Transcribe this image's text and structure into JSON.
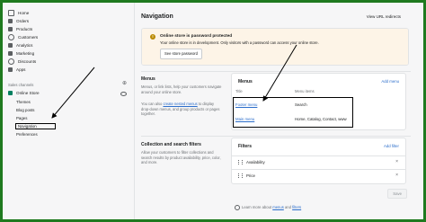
{
  "sidebar": {
    "items": [
      {
        "label": "Home",
        "icon": "home-icon"
      },
      {
        "label": "Orders",
        "icon": "orders-icon"
      },
      {
        "label": "Products",
        "icon": "products-icon"
      },
      {
        "label": "Customers",
        "icon": "customers-icon"
      },
      {
        "label": "Analytics",
        "icon": "analytics-icon"
      },
      {
        "label": "Marketing",
        "icon": "marketing-icon"
      },
      {
        "label": "Discounts",
        "icon": "discounts-icon"
      },
      {
        "label": "Apps",
        "icon": "apps-icon"
      }
    ],
    "channels_title": "Sales channels",
    "online_store": "Online Store",
    "sub_items": [
      "Themes",
      "Blog posts",
      "Pages",
      "Navigation",
      "Preferences"
    ]
  },
  "header": {
    "title": "Navigation",
    "view_url_redirects": "View URL redirects"
  },
  "banner": {
    "title": "Online store is password protected",
    "text": "Your online store is in development. Only visitors with a password can access your online store.",
    "button": "See store password"
  },
  "menus_section": {
    "heading": "Menus",
    "desc_1": "Menus, or link lists, help your customers navigate around your online store.",
    "desc_2_pre": "You can also ",
    "desc_2_link": "create nested menus",
    "desc_2_post": " to display drop-down menus, and group products or pages together.",
    "card_title": "Menus",
    "add_menu": "Add menu",
    "col_title": "Title",
    "col_items": "Menu items",
    "rows": [
      {
        "title": "Footer menu",
        "items": "Search"
      },
      {
        "title": "Main menu",
        "items": "Home, Catalog, Contact, www"
      }
    ]
  },
  "filters_section": {
    "heading": "Collection and search filters",
    "desc": "Allow your customers to filter collections and search results by product availability, price, color, and more.",
    "card_title": "Filters",
    "add_filter": "Add filter",
    "rows": [
      "Availability",
      "Price"
    ]
  },
  "save_label": "Save",
  "footer": {
    "pre": "Learn more about ",
    "link1": "menus",
    "mid": " and ",
    "link2": "filters"
  },
  "colors": {
    "frame": "#1f7a1f",
    "link": "#2c6ecb",
    "warning": "#b98900"
  }
}
